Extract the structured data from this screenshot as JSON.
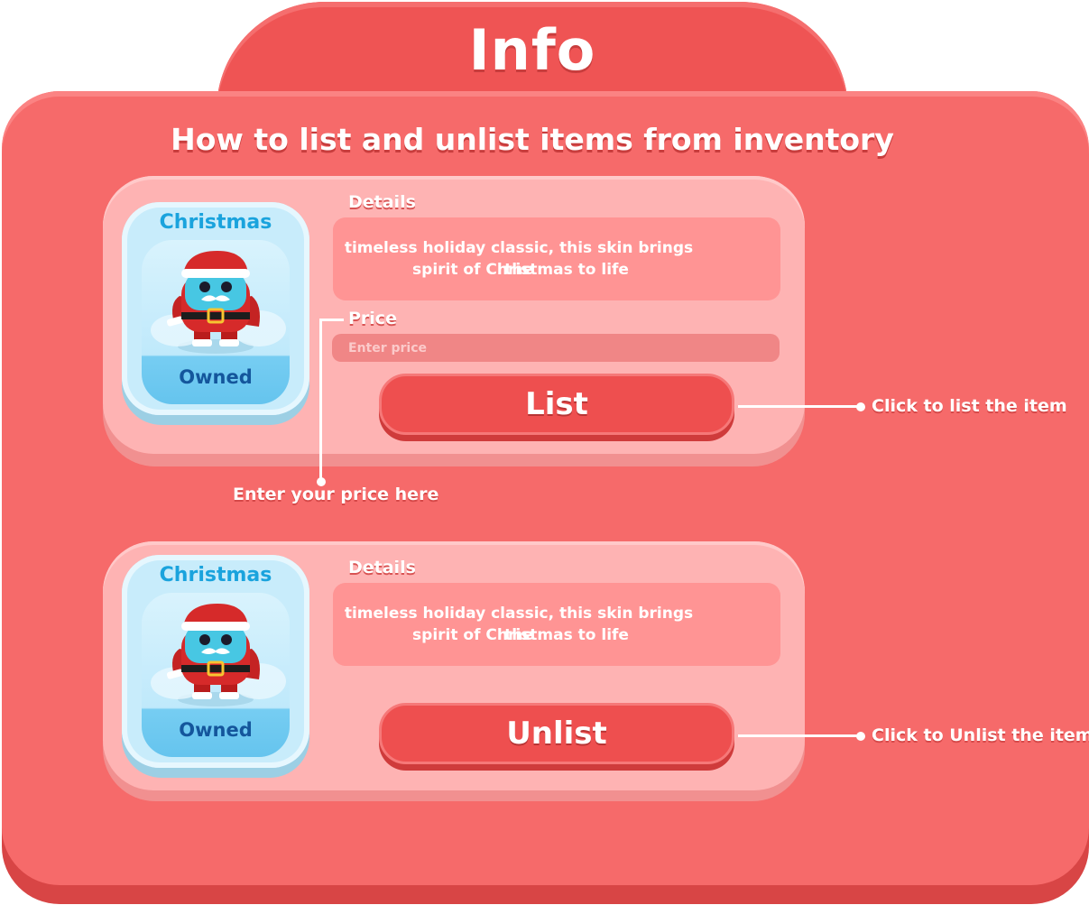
{
  "header": {
    "title": "Info",
    "subtitle": "How to list and unlist items from inventory"
  },
  "colors": {
    "panel": "#f66a6a",
    "tab": "#ef5454",
    "card": "#feb3b3",
    "button": "#ee4f4f",
    "item_name": "#1aa3dd",
    "item_owned": "#14569c"
  },
  "list_card": {
    "item": {
      "name": "Christmas",
      "status": "Owned",
      "icon": "santa-character-icon"
    },
    "details_label": "Details",
    "details_text_line1": "timeless holiday classic, this skin brings the",
    "details_text_line2": "spirit of Christmas to life",
    "price_label": "Price",
    "price_placeholder": "Enter price",
    "price_value": "",
    "button_label": "List"
  },
  "unlist_card": {
    "item": {
      "name": "Christmas",
      "status": "Owned",
      "icon": "santa-character-icon"
    },
    "details_label": "Details",
    "details_text_line1": "timeless holiday classic, this skin brings the",
    "details_text_line2": "spirit of Christmas to life",
    "button_label": "Unlist"
  },
  "callouts": {
    "list": "Click to  list the item",
    "price": "Enter your price here",
    "unlist": "Click to  Unlist the item"
  }
}
